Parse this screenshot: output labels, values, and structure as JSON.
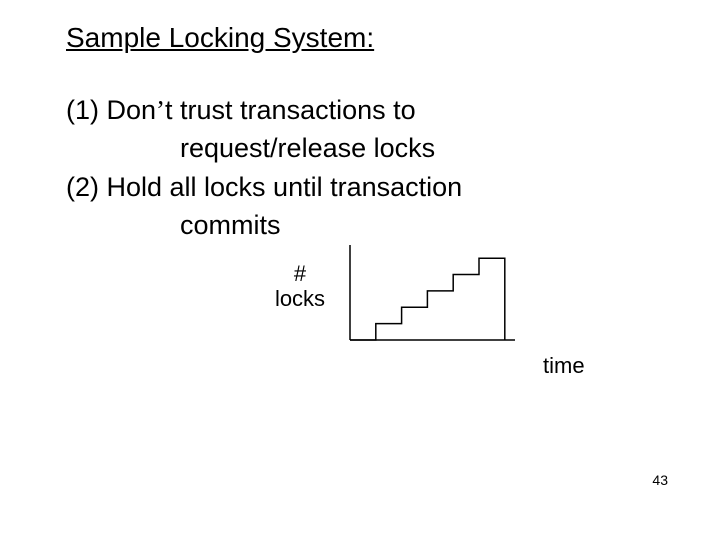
{
  "heading": "Sample Locking System:",
  "points": {
    "p1_l1_a": "(1) Don",
    "p1_l1_b": "t trust transactions to",
    "p1_l2": "request/release locks",
    "p2_l1": "(2) Hold all locks until transaction",
    "p2_l2": "commits"
  },
  "apostrophe": "’",
  "chart_data": {
    "type": "line",
    "ylabel": "#\nlocks",
    "xlabel": "time",
    "description": "Number of locks held by a transaction over time under strict 2PL: monotonically steps up as locks are acquired, then drops to zero at commit.",
    "x": [
      0,
      1,
      1,
      2,
      2,
      3,
      3,
      4,
      4,
      5,
      5,
      6,
      6
    ],
    "values": [
      0,
      0,
      1,
      1,
      2,
      2,
      3,
      3,
      4,
      4,
      5,
      5,
      0
    ],
    "xlim": [
      0,
      6.2
    ],
    "ylim": [
      0,
      5.5
    ]
  },
  "page_number": "43"
}
